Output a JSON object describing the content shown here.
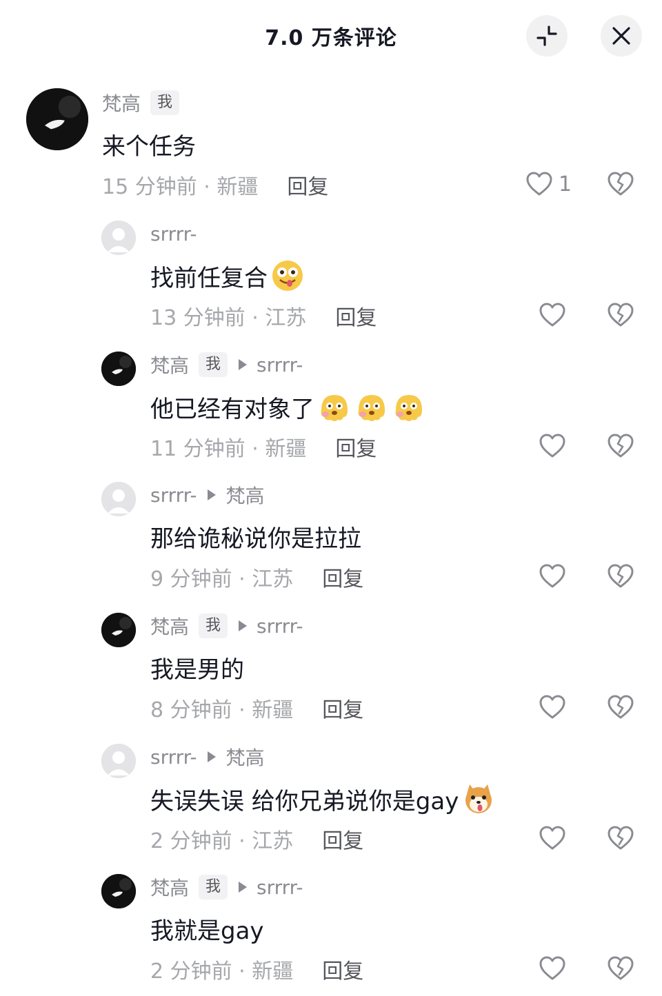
{
  "header": {
    "title": "7.0 万条评论",
    "collapse_icon": "collapse-icon",
    "close_icon": "close-icon"
  },
  "comments": [
    {
      "author": "梵高",
      "badge": "我",
      "reply_to": "",
      "text": "来个任务",
      "time": "15 分钟前 · 新疆",
      "reply_label": "回复",
      "likes": "1",
      "avatar": "dark",
      "emojis": []
    },
    {
      "author": "srrrr-",
      "badge": "",
      "reply_to": "",
      "text": "找前任复合",
      "time": "13 分钟前 · 江苏",
      "reply_label": "回复",
      "likes": "",
      "avatar": "default",
      "emojis": [
        "drooling-face-emoji"
      ]
    },
    {
      "author": "梵高",
      "badge": "我",
      "reply_to": "srrrr-",
      "text": "他已经有对象了",
      "time": "11 分钟前 · 新疆",
      "reply_label": "回复",
      "likes": "",
      "avatar": "dark",
      "emojis": [
        "melting-face-emoji",
        "melting-face-emoji",
        "melting-face-emoji"
      ]
    },
    {
      "author": "srrrr-",
      "badge": "",
      "reply_to": "梵高",
      "text": "那给诡秘说你是拉拉",
      "time": "9 分钟前 · 江苏",
      "reply_label": "回复",
      "likes": "",
      "avatar": "default",
      "emojis": []
    },
    {
      "author": "梵高",
      "badge": "我",
      "reply_to": "srrrr-",
      "text": "我是男的",
      "time": "8 分钟前 · 新疆",
      "reply_label": "回复",
      "likes": "",
      "avatar": "dark",
      "emojis": []
    },
    {
      "author": "srrrr-",
      "badge": "",
      "reply_to": "梵高",
      "text": "失误失误 给你兄弟说你是gay",
      "time": "2 分钟前 · 江苏",
      "reply_label": "回复",
      "likes": "",
      "avatar": "default",
      "emojis": [
        "shiba-dog-emoji"
      ]
    },
    {
      "author": "梵高",
      "badge": "我",
      "reply_to": "srrrr-",
      "text": "我就是gay",
      "time": "2 分钟前 · 新疆",
      "reply_label": "回复",
      "likes": "",
      "avatar": "dark",
      "emojis": []
    }
  ],
  "colors": {
    "text_primary": "#161823",
    "text_secondary": "#8a8b91",
    "text_meta": "#a6a7ab",
    "emoji_yellow": "#f7c948"
  }
}
